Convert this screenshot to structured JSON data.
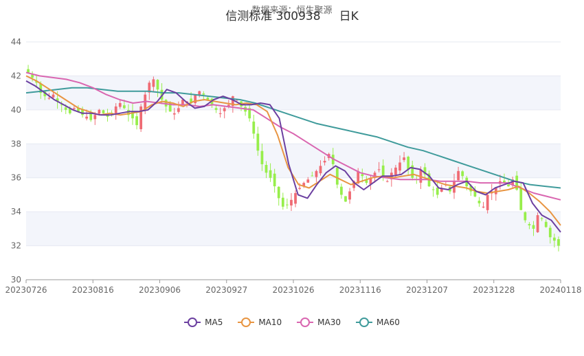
{
  "header": {
    "source": "数据来源：恒生聚源",
    "title": "信测标准 300938     日K"
  },
  "colors": {
    "up": "#ef6b74",
    "down": "#97ee4b",
    "grid": "#e6e9f2",
    "band": "#f3f5fb",
    "MA5": "#6b3fa0",
    "MA10": "#e89542",
    "MA30": "#d966b0",
    "MA60": "#3f9b9b"
  },
  "chart_data": {
    "type": "candlestick",
    "title": "信测标准 300938 日K",
    "ylim": [
      30,
      44
    ],
    "y_ticks": [
      30,
      32,
      34,
      36,
      38,
      40,
      42,
      44
    ],
    "x_tick_labels": [
      "20230726",
      "20230816",
      "20230906",
      "20230927",
      "20231026",
      "20231116",
      "20231207",
      "20231228",
      "20240118"
    ],
    "legend": [
      "MA5",
      "MA10",
      "MA30",
      "MA60"
    ],
    "legend_position": "bottom-center",
    "closes": [
      42.2,
      41.9,
      41.6,
      41.0,
      40.8,
      40.7,
      40.9,
      40.5,
      40.3,
      40.0,
      39.8,
      40.1,
      39.9,
      39.7,
      39.6,
      39.4,
      39.7,
      40.0,
      39.8,
      39.6,
      39.8,
      40.2,
      40.4,
      40.1,
      39.7,
      39.5,
      39.1,
      40.2,
      40.9,
      41.6,
      41.8,
      41.2,
      40.6,
      40.2,
      39.9,
      39.8,
      40.1,
      40.6,
      40.5,
      40.4,
      40.9,
      41.1,
      40.9,
      40.6,
      40.3,
      40.0,
      39.8,
      40.1,
      40.3,
      40.8,
      40.6,
      40.2,
      39.9,
      39.5,
      38.6,
      37.6,
      36.8,
      36.3,
      36.0,
      35.5,
      34.8,
      34.3,
      34.4,
      34.7,
      35.1,
      35.4,
      35.7,
      35.9,
      36.1,
      36.4,
      36.7,
      37.0,
      37.4,
      36.8,
      35.6,
      35.0,
      34.6,
      35.2,
      35.8,
      36.4,
      36.1,
      35.7,
      36.0,
      36.3,
      36.5,
      36.0,
      35.8,
      36.3,
      36.6,
      36.9,
      37.2,
      36.5,
      36.0,
      35.9,
      36.5,
      36.2,
      35.5,
      35.3,
      35.0,
      35.4,
      35.6,
      35.2,
      35.8,
      36.4,
      36.1,
      35.5,
      35.2,
      34.9,
      34.5,
      34.3,
      35.0,
      35.2,
      35.4,
      35.8,
      35.7,
      35.5,
      35.9,
      35.3,
      34.1,
      33.5,
      33.2,
      33.0,
      33.8,
      33.6,
      33.1,
      32.5,
      32.3,
      32.0
    ],
    "ma": {
      "MA5": [
        41.7,
        41.4,
        41.0,
        40.6,
        40.3,
        40.0,
        39.8,
        39.8,
        39.7,
        39.7,
        39.8,
        39.9,
        39.9,
        40.0,
        40.5,
        41.2,
        41.0,
        40.5,
        40.1,
        40.2,
        40.6,
        40.8,
        40.6,
        40.3,
        40.3,
        40.4,
        40.3,
        39.5,
        36.8,
        35.0,
        34.8,
        35.6,
        36.3,
        36.7,
        36.4,
        35.7,
        35.3,
        35.7,
        36.1,
        36.1,
        36.2,
        36.6,
        36.5,
        36.1,
        35.4,
        35.3,
        35.6,
        35.8,
        35.2,
        35.0,
        35.4,
        35.6,
        35.8,
        35.7,
        34.5,
        33.8,
        33.5,
        32.8
      ],
      "MA10": [
        42.0,
        41.7,
        41.3,
        40.9,
        40.5,
        40.1,
        39.9,
        39.7,
        39.8,
        39.7,
        39.8,
        39.9,
        40.3,
        40.5,
        40.4,
        40.2,
        40.5,
        40.6,
        40.5,
        40.4,
        40.3,
        40.4,
        40.3,
        39.9,
        38.5,
        36.6,
        35.6,
        35.4,
        35.8,
        36.2,
        35.9,
        35.6,
        35.8,
        36.0,
        36.1,
        36.0,
        36.1,
        36.2,
        36.0,
        35.8,
        35.6,
        35.5,
        35.4,
        35.2,
        35.1,
        35.2,
        35.3,
        35.5,
        35.1,
        34.6,
        34.0,
        33.2
      ],
      "MA30": [
        42.2,
        42.0,
        41.9,
        41.8,
        41.6,
        41.3,
        40.9,
        40.6,
        40.4,
        40.5,
        40.4,
        40.3,
        40.3,
        40.2,
        40.3,
        40.2,
        40.1,
        40.0,
        39.5,
        39.0,
        38.6,
        38.1,
        37.6,
        37.1,
        36.7,
        36.3,
        36.1,
        36.0,
        35.9,
        35.9,
        35.9,
        35.8,
        35.8,
        35.8,
        35.7,
        35.7,
        35.7,
        35.4,
        35.1,
        34.9,
        34.7
      ],
      "MA60": [
        41.0,
        41.1,
        41.2,
        41.3,
        41.3,
        41.2,
        41.1,
        41.1,
        41.1,
        41.0,
        41.0,
        40.9,
        40.8,
        40.7,
        40.6,
        40.4,
        40.1,
        39.8,
        39.5,
        39.2,
        39.0,
        38.8,
        38.6,
        38.4,
        38.1,
        37.8,
        37.6,
        37.3,
        37.0,
        36.7,
        36.4,
        36.1,
        35.8,
        35.6,
        35.5,
        35.4
      ]
    }
  }
}
